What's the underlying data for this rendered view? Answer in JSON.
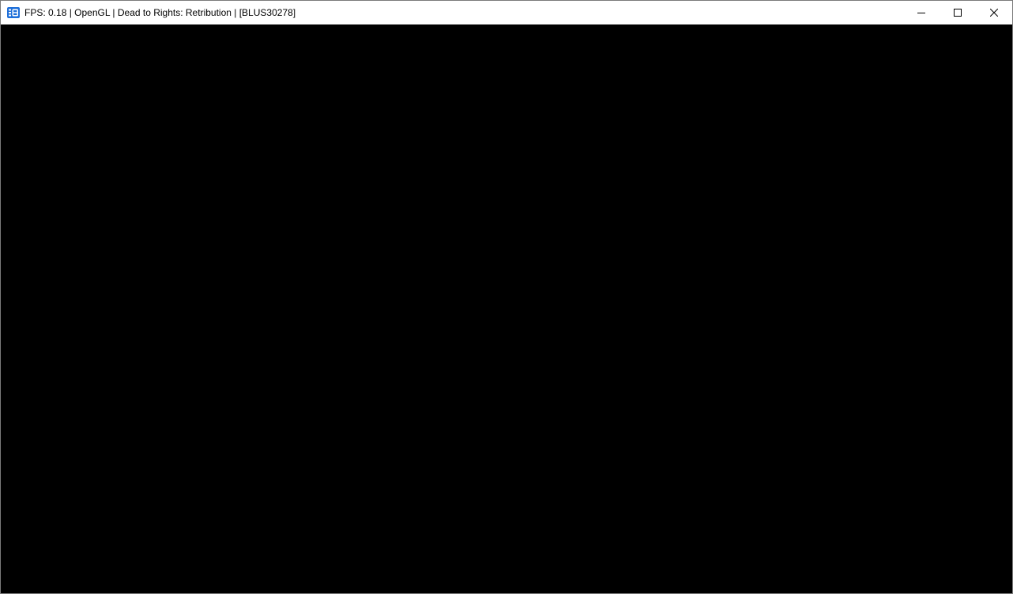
{
  "window": {
    "title": "FPS: 0.18 | OpenGL | Dead to Rights: Retribution | [BLUS30278]",
    "app_icon": "rpcs3-icon",
    "accent_color": "#1e6fd9",
    "viewport_color": "#000000"
  },
  "caption_buttons": {
    "minimize_icon": "minimize-icon",
    "maximize_icon": "maximize-icon",
    "close_icon": "close-icon"
  }
}
